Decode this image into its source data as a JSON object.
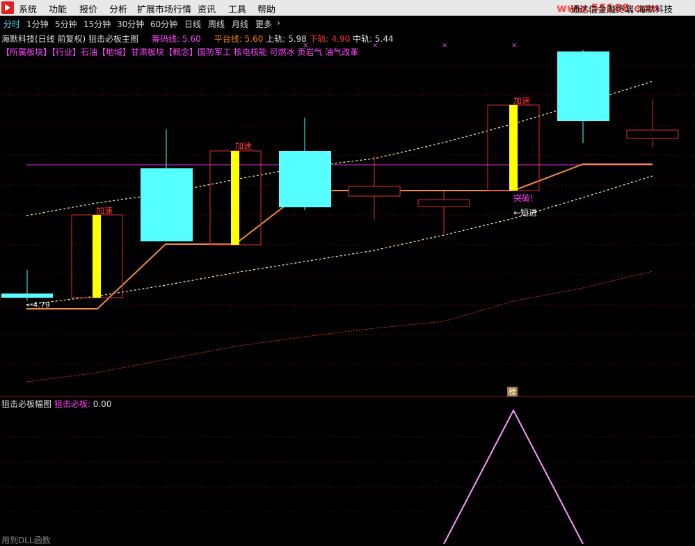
{
  "menubar": {
    "items": [
      "系统",
      "功能",
      "报价",
      "分析",
      "扩展市场行情",
      "资讯",
      "工具",
      "帮助"
    ],
    "right_text": "通达信金融终端 海默科技",
    "watermark": "www.55188.com"
  },
  "periods": {
    "items": [
      "分时",
      "1分钟",
      "5分钟",
      "15分钟",
      "30分钟",
      "60分钟",
      "日线",
      "周线",
      "月线",
      "更多",
      "›"
    ],
    "active_index": 0
  },
  "main_info": {
    "stock": "海默科技(日线 前复权)",
    "indicator": "狙击必板主图",
    "chouma_label": "筹码线:",
    "chouma_val": "5.60",
    "pingtai_label": "平台线:",
    "pingtai_val": "5.60",
    "shanggui_label": "上轨:",
    "shanggui_val": "5.98",
    "xiagui_label": "下轨:",
    "xiagui_val": "4.90",
    "zhonggui_label": "中轨:",
    "zhonggui_val": "5.44"
  },
  "sector_line": "【所属板块】【行业】石油【地域】甘肃板块【概念】国防军工 核电核能 可燃冰 页岩气 油气改革",
  "sub_info": {
    "title": "狙击必板幅图",
    "label": "狙击必板:",
    "value": "0.00"
  },
  "footer": "用到DLL函数",
  "annotations": {
    "jiasu": "加速",
    "tupo": "突破!",
    "duanjin": "←短进",
    "low_price": "←4.79",
    "bang": "榜"
  },
  "colors": {
    "cyan": "#5ff",
    "yellow": "#ff0",
    "red": "#f33",
    "orange": "#f84",
    "magenta": "#f4f",
    "pink": "#f9f"
  }
}
